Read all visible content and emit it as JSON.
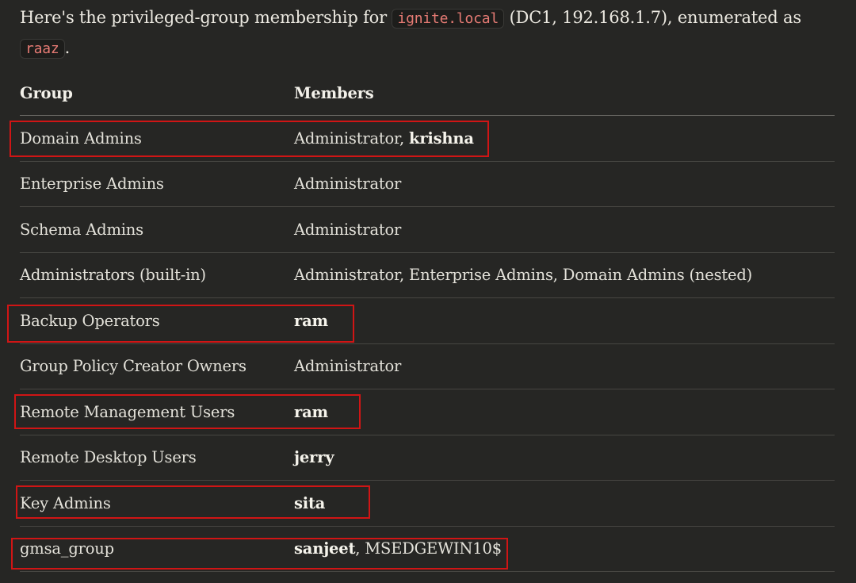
{
  "intro": {
    "text_before": "Here's the privileged-group membership for ",
    "domain": "ignite.local",
    "text_middle": " (DC1, 192.168.1.7), enumerated as ",
    "user": "raaz",
    "text_after": "."
  },
  "table": {
    "headers": {
      "group": "Group",
      "members": "Members"
    },
    "rows": [
      {
        "group": "Domain Admins",
        "members": [
          {
            "text": "Administrator, "
          },
          {
            "text": "krishna",
            "bold": true
          }
        ],
        "highlighted": true
      },
      {
        "group": "Enterprise Admins",
        "members": [
          {
            "text": "Administrator"
          }
        ],
        "highlighted": false
      },
      {
        "group": "Schema Admins",
        "members": [
          {
            "text": "Administrator"
          }
        ],
        "highlighted": false
      },
      {
        "group": "Administrators (built-in)",
        "members": [
          {
            "text": "Administrator, Enterprise Admins, Domain Admins (nested)"
          }
        ],
        "highlighted": false
      },
      {
        "group": "Backup Operators",
        "members": [
          {
            "text": "ram",
            "bold": true
          }
        ],
        "highlighted": true
      },
      {
        "group": "Group Policy Creator Owners",
        "members": [
          {
            "text": "Administrator"
          }
        ],
        "highlighted": false
      },
      {
        "group": "Remote Management Users",
        "members": [
          {
            "text": "ram",
            "bold": true
          }
        ],
        "highlighted": true
      },
      {
        "group": "Remote Desktop Users",
        "members": [
          {
            "text": "jerry",
            "bold": true
          }
        ],
        "highlighted": false
      },
      {
        "group": "Key Admins",
        "members": [
          {
            "text": "sita",
            "bold": true
          }
        ],
        "highlighted": true
      },
      {
        "group": "gmsa_group",
        "members": [
          {
            "text": "sanjeet",
            "bold": true
          },
          {
            "text": ", MSEDGEWIN10$"
          }
        ],
        "highlighted": true
      }
    ]
  },
  "colors": {
    "background": "#262624",
    "highlight_box": "#d01515",
    "inline_code": "#e67b74"
  }
}
